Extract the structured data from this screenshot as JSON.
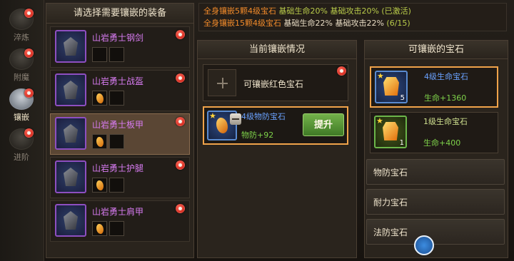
{
  "nav": [
    {
      "label": "淬炼",
      "active": false
    },
    {
      "label": "附魔",
      "active": false
    },
    {
      "label": "镶嵌",
      "active": true
    },
    {
      "label": "进阶",
      "active": false
    }
  ],
  "equip": {
    "title": "请选择需要镶嵌的装备",
    "items": [
      {
        "name": "山岩勇士钢剑",
        "gems": [
          false,
          false
        ]
      },
      {
        "name": "山岩勇士战盔",
        "gems": [
          true,
          false
        ]
      },
      {
        "name": "山岩勇士板甲",
        "gems": [
          true,
          false
        ]
      },
      {
        "name": "山岩勇士护腿",
        "gems": [
          true,
          false
        ]
      },
      {
        "name": "山岩勇士肩甲",
        "gems": [
          true,
          false
        ]
      }
    ]
  },
  "banner": {
    "line1_a": "全身镶嵌5颗4级宝石",
    "line1_b": "基础生命20% 基础攻击20% (已激活)",
    "line2_a": "全身镶嵌15颗4级宝石",
    "line2_b": "基础生命22% 基础攻击22%",
    "line2_c": "(6/15)"
  },
  "mid": {
    "title": "当前镶嵌情况",
    "empty_slot_label": "可镶嵌红色宝石",
    "filled": {
      "name": "4级物防宝石",
      "stat": "物防+92",
      "button": "提升"
    }
  },
  "right": {
    "title": "可镶嵌的宝石",
    "gems": [
      {
        "name": "4级生命宝石",
        "stat": "生命+1360",
        "count": "5"
      },
      {
        "name": "1级生命宝石",
        "stat": "生命+400",
        "count": "1"
      }
    ],
    "categories": [
      "物防宝石",
      "耐力宝石",
      "法防宝石"
    ]
  },
  "colors": {
    "accent": "#f0a34a",
    "red_dot": "#c8170c",
    "purple_name": "#d77bf0"
  }
}
